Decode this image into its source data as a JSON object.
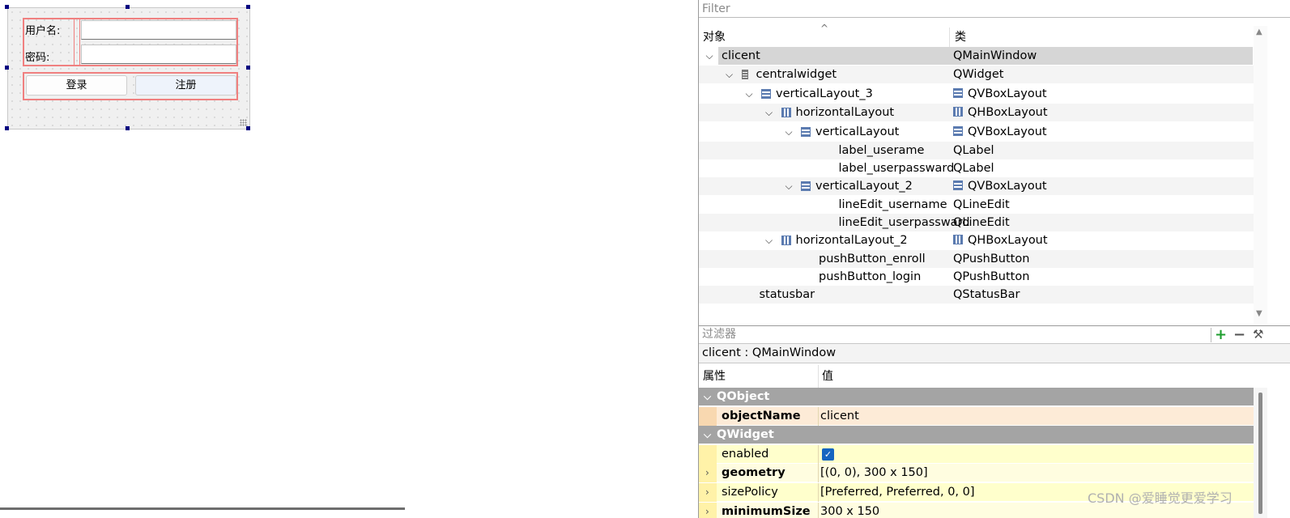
{
  "form": {
    "username_label": "用户名:",
    "password_label": "密码:",
    "login_button": "登录",
    "register_button": "注册"
  },
  "object_inspector": {
    "filter_placeholder": "Filter",
    "col_object": "对象",
    "col_class": "类",
    "tree": [
      {
        "name": "clicent",
        "class": "QMainWindow",
        "icon": "",
        "class_icon": "",
        "expanded": true,
        "selected": true
      },
      {
        "name": "centralwidget",
        "class": "QWidget",
        "icon": "grid-layout-icon",
        "class_icon": "",
        "expanded": true
      },
      {
        "name": "verticalLayout_3",
        "class": "QVBoxLayout",
        "icon": "vbox-layout-icon",
        "class_icon": "vbox-layout-icon",
        "expanded": true
      },
      {
        "name": "horizontalLayout",
        "class": "QHBoxLayout",
        "icon": "hbox-layout-icon",
        "class_icon": "hbox-layout-icon",
        "expanded": true
      },
      {
        "name": "verticalLayout",
        "class": "QVBoxLayout",
        "icon": "vbox-layout-icon",
        "class_icon": "vbox-layout-icon",
        "expanded": true
      },
      {
        "name": "label_userame",
        "class": "QLabel",
        "icon": "",
        "class_icon": ""
      },
      {
        "name": "label_userpassward",
        "class": "QLabel",
        "icon": "",
        "class_icon": ""
      },
      {
        "name": "verticalLayout_2",
        "class": "QVBoxLayout",
        "icon": "vbox-layout-icon",
        "class_icon": "vbox-layout-icon",
        "expanded": true
      },
      {
        "name": "lineEdit_username",
        "class": "QLineEdit",
        "icon": "",
        "class_icon": ""
      },
      {
        "name": "lineEdit_userpassward",
        "class": "QLineEdit",
        "icon": "",
        "class_icon": ""
      },
      {
        "name": "horizontalLayout_2",
        "class": "QHBoxLayout",
        "icon": "hbox-layout-icon",
        "class_icon": "hbox-layout-icon",
        "expanded": true
      },
      {
        "name": "pushButton_enroll",
        "class": "QPushButton",
        "icon": "",
        "class_icon": ""
      },
      {
        "name": "pushButton_login",
        "class": "QPushButton",
        "icon": "",
        "class_icon": ""
      },
      {
        "name": "statusbar",
        "class": "QStatusBar",
        "icon": "",
        "class_icon": ""
      }
    ]
  },
  "property_editor": {
    "filter_placeholder": "过滤器",
    "object_title": "clicent : QMainWindow",
    "col_property": "属性",
    "col_value": "值",
    "rows": [
      {
        "type": "group",
        "name": "QObject"
      },
      {
        "type": "prop",
        "name": "objectName",
        "value": "clicent",
        "bold": true,
        "style": "orange"
      },
      {
        "type": "group",
        "name": "QWidget"
      },
      {
        "type": "prop",
        "name": "enabled",
        "value": "",
        "checked": true,
        "style": "yellow"
      },
      {
        "type": "prop",
        "name": "geometry",
        "value": "[(0, 0), 300 x 150]",
        "bold": true,
        "expandable": true,
        "style": "yellow2"
      },
      {
        "type": "prop",
        "name": "sizePolicy",
        "value": "[Preferred, Preferred, 0, 0]",
        "expandable": true,
        "style": "yellow"
      },
      {
        "type": "prop",
        "name": "minimumSize",
        "value": "300 x 150",
        "bold": true,
        "expandable": true,
        "style": "yellow2"
      }
    ]
  },
  "watermark": "CSDN @爱睡觉更爱学习"
}
